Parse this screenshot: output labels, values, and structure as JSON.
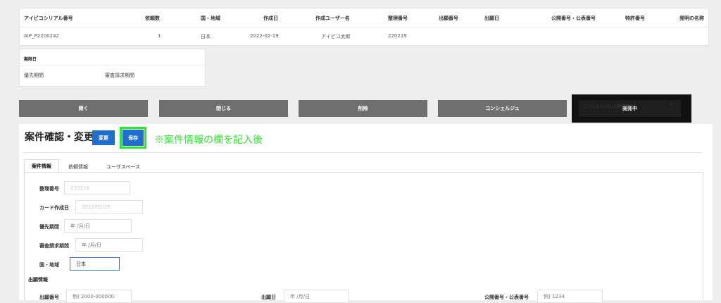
{
  "summary": {
    "headers": [
      "アイピコシリアル番号",
      "依頼数",
      "国・地域",
      "作成日",
      "作成ユーザー名",
      "整理番号",
      "出願番号",
      "出願日",
      "公開番号・公表番号",
      "特許番号",
      "発明の名称"
    ],
    "values": [
      "AIP_P2200242",
      "1",
      "日本",
      "2022-02-19",
      "アイピコ太郎",
      "220219",
      "",
      "",
      "",
      "",
      ""
    ]
  },
  "deadline": {
    "title": "期限日",
    "labels": [
      "優先期間",
      "審査請求期間"
    ]
  },
  "actions": {
    "open": "開く",
    "close": "閉じる",
    "delete": "削除",
    "concierge": "コンシェルジュ",
    "dev": "開発中",
    "dev_ghost": "コンシェルジュの期限表示",
    "dev_ghost_arrow": "→"
  },
  "case": {
    "title": "案件確認・変更",
    "change_label": "変更",
    "save_label": "保存",
    "note": "※案件情報の欄を記入後"
  },
  "tabs": [
    "案件情報",
    "依頼情報",
    "ユーザスペース"
  ],
  "form": {
    "ref_no": {
      "label": "整理番号",
      "value": "220219"
    },
    "card_date": {
      "label": "カード作成日",
      "value": "2022/02/19"
    },
    "priority": {
      "label": "優先期間",
      "placeholder": "年 /月/日"
    },
    "exam": {
      "label": "審査請求期間",
      "placeholder": "年 /月/日"
    },
    "country": {
      "label": "国・地域",
      "value": "日本"
    }
  },
  "filing": {
    "section": "出願情報",
    "app_no": {
      "label": "出願番号",
      "placeholder": "例) 2000-000000"
    },
    "app_date": {
      "label": "出願日",
      "placeholder": "年 /月/日"
    },
    "pub_no": {
      "label": "公開番号・公表番号",
      "placeholder": "例) 1234"
    }
  }
}
